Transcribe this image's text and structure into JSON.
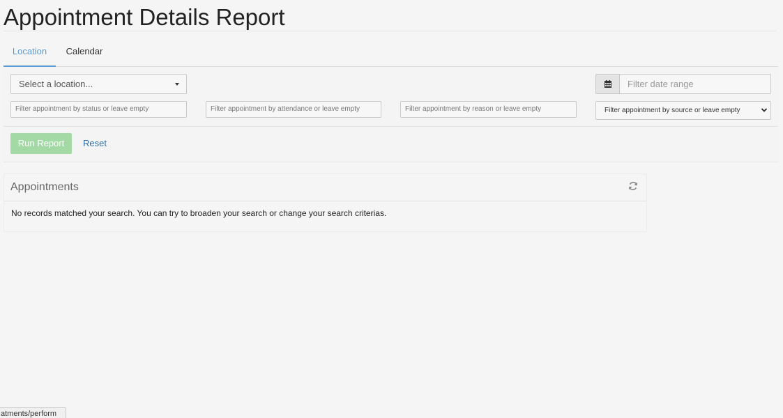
{
  "page": {
    "title": "Appointment Details Report"
  },
  "tabs": [
    {
      "label": "Location",
      "active": true
    },
    {
      "label": "Calendar",
      "active": false
    }
  ],
  "filters": {
    "location_select": {
      "value": "Select a location..."
    },
    "date_range": {
      "placeholder": "Filter date range",
      "icon": "calendar-icon"
    },
    "status": {
      "placeholder": "Filter appointment by status or leave empty"
    },
    "attendance": {
      "placeholder": "Filter appointment by attendance or leave empty"
    },
    "reason": {
      "placeholder": "Filter appointment by reason or leave empty"
    },
    "source": {
      "value": "Filter appointment by source or leave empty"
    }
  },
  "actions": {
    "run_label": "Run Report",
    "reset_label": "Reset"
  },
  "appointments": {
    "title": "Appointments",
    "refresh_icon": "refresh-icon",
    "empty_message": "No records matched your search. You can try to broaden your search or change your search criterias."
  },
  "status_bar": {
    "url_text": "atments/perform"
  },
  "colors": {
    "background": "#f5f5f5",
    "active_tab": "#5b9bd5",
    "run_button": "#a3d9a5",
    "link": "#2f6ea8"
  }
}
